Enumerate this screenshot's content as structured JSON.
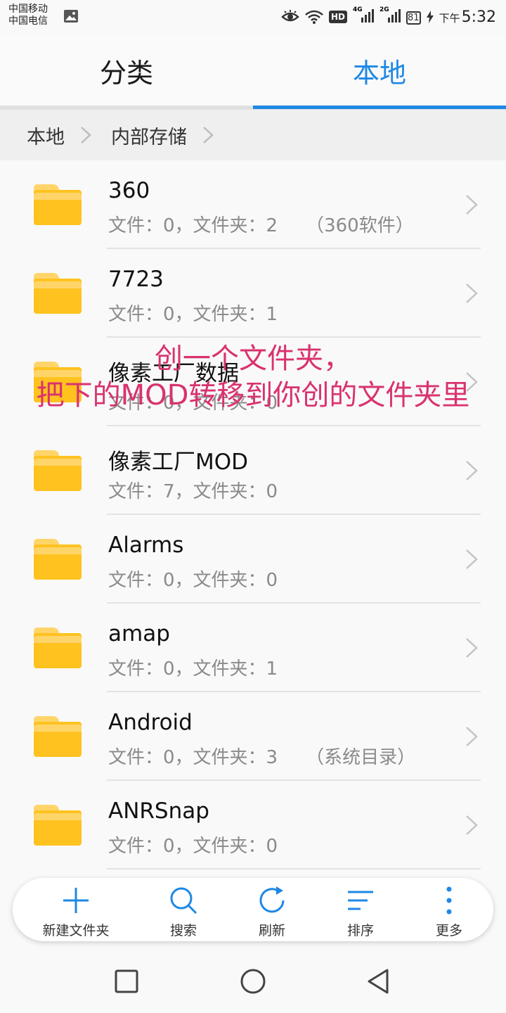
{
  "status_bar": {
    "carrier_1": "中国移动",
    "carrier_2": "中国电信",
    "network_badge": "HD",
    "signal_1_tag": "4G",
    "signal_2_tag": "2G",
    "battery": "81",
    "time_prefix": "下午",
    "time": "5:32"
  },
  "tabs": {
    "category_label": "分类",
    "local_label": "本地",
    "active": "本地",
    "accent_color": "#1e88e5"
  },
  "breadcrumb": {
    "items": [
      "本地",
      "内部存储"
    ]
  },
  "files": [
    {
      "name": "360",
      "meta": "文件：0，文件夹：2",
      "note": "（360软件）"
    },
    {
      "name": "7723",
      "meta": "文件：0，文件夹：1",
      "note": ""
    },
    {
      "name": "像素工厂数据",
      "meta": "文件：0，文件夹：0",
      "note": ""
    },
    {
      "name": "像素工厂MOD",
      "meta": "文件：7，文件夹：0",
      "note": ""
    },
    {
      "name": "Alarms",
      "meta": "文件：0，文件夹：0",
      "note": ""
    },
    {
      "name": "amap",
      "meta": "文件：0，文件夹：1",
      "note": ""
    },
    {
      "name": "Android",
      "meta": "文件：0，文件夹：3",
      "note": "（系统目录）"
    },
    {
      "name": "ANRSnap",
      "meta": "文件：0，文件夹：0",
      "note": ""
    }
  ],
  "overlay_annotation": {
    "line1": "创一个文件夹，",
    "line2": "把下的MOD转移到你创的文件夹里",
    "color": "#d9326f"
  },
  "toolbar": {
    "new_folder": "新建文件夹",
    "search": "搜索",
    "refresh": "刷新",
    "sort": "排序",
    "more": "更多"
  },
  "icons": {
    "folder": "folder-icon",
    "chevron": "chevron-right-icon",
    "plus": "plus-icon",
    "search": "search-icon",
    "refresh": "refresh-icon",
    "sort": "sort-icon",
    "more": "more-vertical-icon"
  }
}
